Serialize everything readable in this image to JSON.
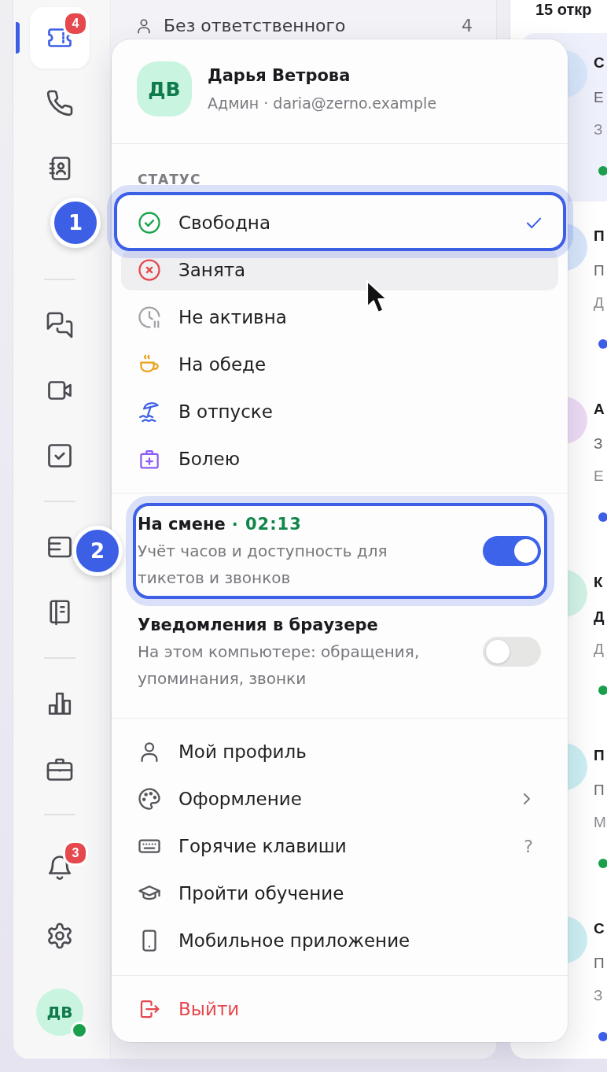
{
  "sidebar": {
    "groups": [
      {
        "items": [
          {
            "selected": true,
            "badge": "4"
          },
          {
            "selected": false
          },
          {
            "selected": false
          }
        ]
      },
      {
        "items": [
          {
            "selected": false
          },
          {
            "selected": false
          },
          {
            "selected": false
          }
        ]
      },
      {
        "items": [
          {
            "selected": false
          },
          {
            "selected": false
          }
        ]
      },
      {
        "items": [
          {
            "selected": false
          },
          {
            "selected": false
          }
        ]
      }
    ],
    "bottom_items": [
      {
        "selected": false,
        "badge": "3"
      },
      {
        "selected": false
      }
    ],
    "user": {
      "initials": "ДВ",
      "online": true
    }
  },
  "queue_panel": {
    "items": [
      {
        "label": "Без ответственного",
        "count": "4"
      }
    ]
  },
  "tickets_panel": {
    "title": "15 откр",
    "cards": [
      {
        "title": "С",
        "line_2": "Е",
        "line_3": "З",
        "selected": true,
        "unread": false,
        "avatar": {
          "color": "#d8e7fb"
        },
        "color": "#1a9f4a"
      },
      {
        "title": "П",
        "line_2": "П",
        "line_3": "Д",
        "selected": false,
        "unread": false,
        "avatar": {
          "color": "#d8e7fb"
        },
        "color": "#3d5fe6"
      },
      {
        "title": "А",
        "line_2": "З",
        "line_3": "Е",
        "selected": false,
        "unread": false,
        "avatar": {
          "color": "#eedcf6"
        },
        "color": "#3d5fe6"
      },
      {
        "title": "К",
        "line_2": "Д",
        "line_3": "Д",
        "selected": false,
        "unread": true,
        "avatar": {
          "color": "#d2f4e5"
        },
        "color": "#1a9f4a"
      },
      {
        "title": "П",
        "line_2": "П",
        "line_3": "М",
        "selected": false,
        "unread": false,
        "avatar": {
          "color": "#cdf0f4"
        },
        "color": "#1a9f4a"
      },
      {
        "title": "С",
        "line_2": "П",
        "line_3": "З",
        "selected": false,
        "unread": false,
        "avatar": {
          "color": "#cdf0f4"
        },
        "color": "#3d5fe6"
      }
    ]
  },
  "profile_menu": {
    "user": {
      "initials": "ДВ",
      "name": "Дарья Ветрова",
      "subtitle": "Админ · daria@zerno.example"
    },
    "status": {
      "heading": "СТАТУС",
      "items": [
        {
          "label": "Свободна",
          "selected": true,
          "hovered": false,
          "highlighted": true,
          "callout": "1"
        },
        {
          "label": "Занята",
          "selected": false,
          "hovered": true,
          "highlighted": false
        },
        {
          "label": "Не активна",
          "selected": false,
          "hovered": false,
          "highlighted": false
        },
        {
          "label": "На обеде",
          "selected": false,
          "hovered": false,
          "highlighted": false
        },
        {
          "label": "В отпуске",
          "selected": false,
          "hovered": false,
          "highlighted": false
        },
        {
          "label": "Болею",
          "selected": false,
          "hovered": false,
          "highlighted": false
        }
      ]
    },
    "toggles": [
      {
        "title": "На смене",
        "timer": "· 02:13",
        "description": "Учёт часов и доступность для тикетов и звонков",
        "on": true,
        "highlighted": true,
        "callout": "2"
      },
      {
        "title": "Уведомления в браузере",
        "description": "На этом компьютере: обращения, упоминания, звонки",
        "on": false,
        "highlighted": false
      }
    ],
    "items": [
      {
        "label": "Мой профиль",
        "kind": "link"
      },
      {
        "label": "Оформление",
        "kind": "submenu"
      },
      {
        "label": "Горячие клавиши",
        "kind": "shortcut",
        "hint": "?"
      },
      {
        "label": "Пройти обучение",
        "kind": "link"
      },
      {
        "label": "Мобильное приложение",
        "kind": "link"
      }
    ],
    "logout": {
      "label": "Выйти"
    }
  }
}
